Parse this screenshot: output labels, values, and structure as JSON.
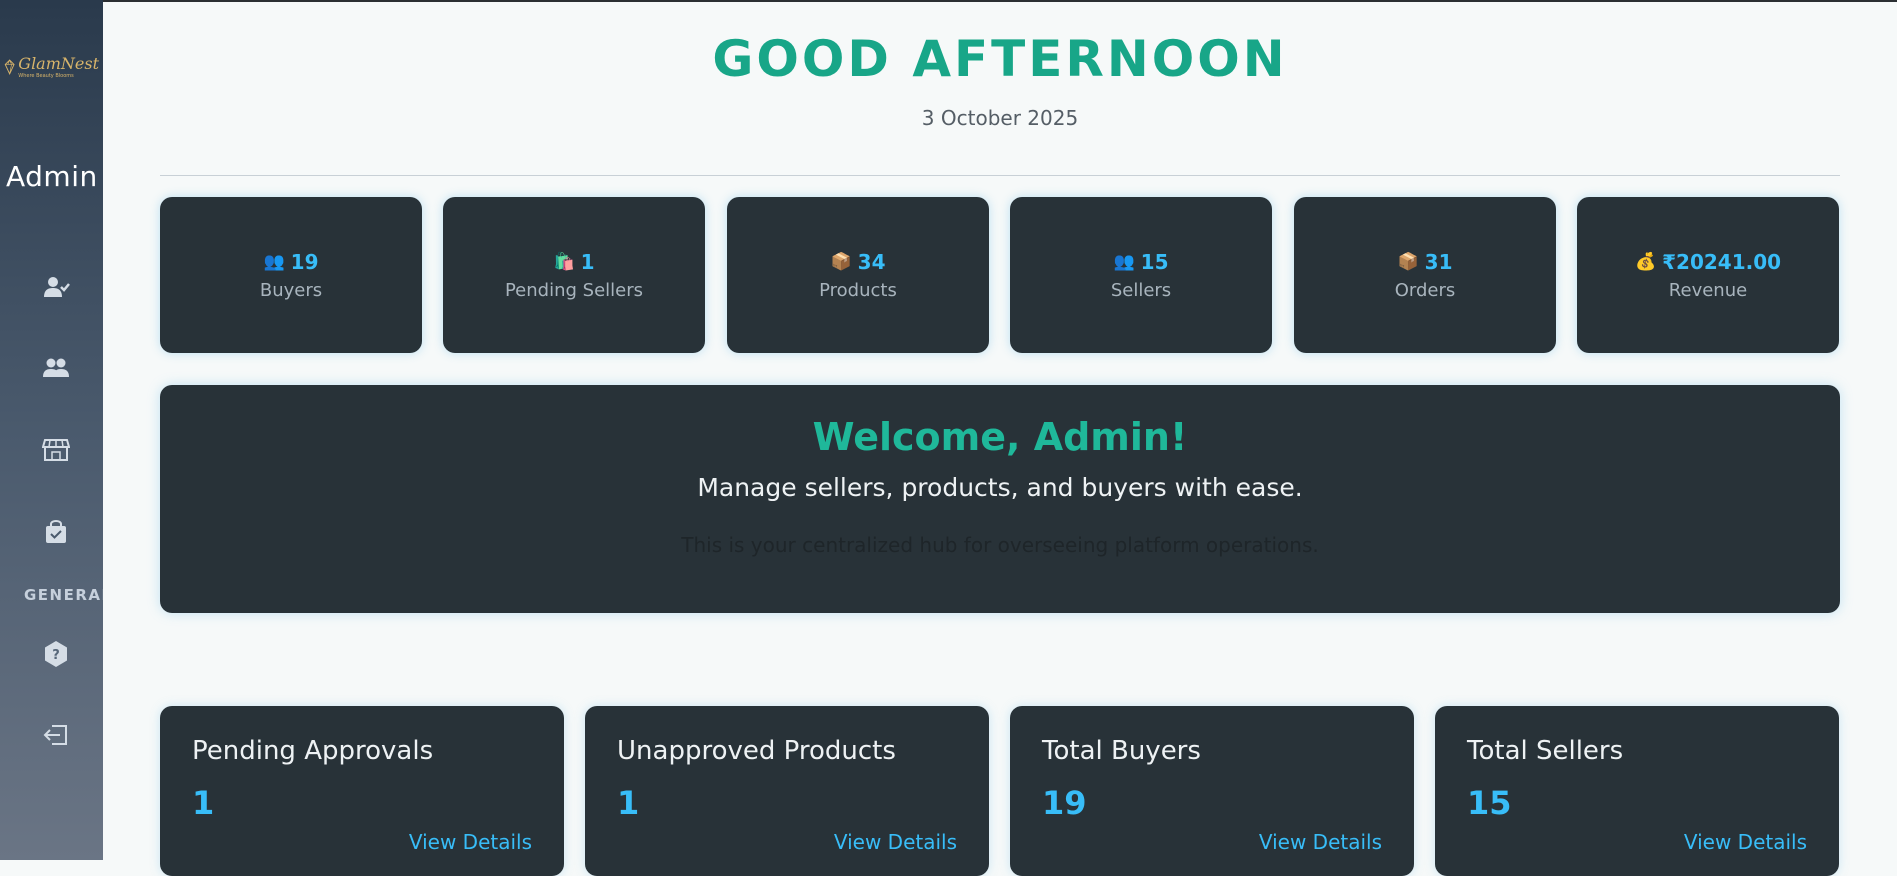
{
  "brand": {
    "name": "GlamNest",
    "tagline": "Where Beauty Blooms"
  },
  "sidebar": {
    "role_label": "Admin",
    "nav_icons": [
      "user-check-icon",
      "users-icon",
      "store-icon",
      "shopping-bag-icon"
    ],
    "section_label": "GENERAL",
    "general_icons": [
      "help-icon",
      "logout-icon"
    ]
  },
  "header": {
    "greeting": "GOOD AFTERNOON",
    "date": "3 October 2025"
  },
  "stats": [
    {
      "icon": "👥",
      "icon_name": "buyers-icon",
      "value": "19",
      "label": "Buyers"
    },
    {
      "icon": "🛍️",
      "icon_name": "shopping-bags-icon",
      "value": "1",
      "label": "Pending Sellers"
    },
    {
      "icon": "📦",
      "icon_name": "package-icon",
      "value": "34",
      "label": "Products"
    },
    {
      "icon": "👥",
      "icon_name": "sellers-icon",
      "value": "15",
      "label": "Sellers"
    },
    {
      "icon": "📦",
      "icon_name": "orders-package-icon",
      "value": "31",
      "label": "Orders"
    },
    {
      "icon": "💰",
      "icon_name": "money-bag-icon",
      "value": "₹20241.00",
      "label": "Revenue"
    }
  ],
  "welcome": {
    "title": "Welcome, Admin!",
    "subtitle": "Manage sellers, products, and buyers with ease.",
    "note": "This is your centralized hub for overseeing platform operations."
  },
  "cards": [
    {
      "title": "Pending Approvals",
      "value": "1",
      "link": "View Details"
    },
    {
      "title": "Unapproved Products",
      "value": "1",
      "link": "View Details"
    },
    {
      "title": "Total Buyers",
      "value": "19",
      "link": "View Details"
    },
    {
      "title": "Total Sellers",
      "value": "15",
      "link": "View Details"
    }
  ],
  "colors": {
    "accent": "#18a688",
    "value_blue": "#38bdf8",
    "card_bg": "#283238",
    "sidebar_top": "#2a3a4c",
    "sidebar_bottom": "#6a7585",
    "page_bg": "#f6f9f9"
  }
}
